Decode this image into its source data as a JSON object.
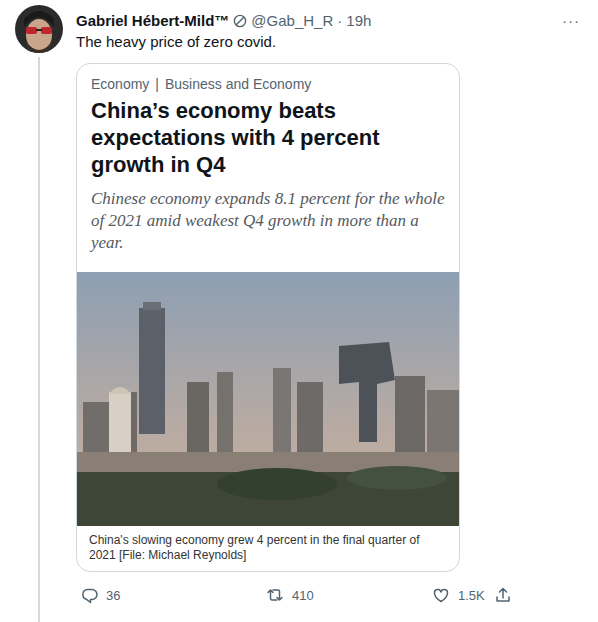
{
  "tweet": {
    "author": {
      "name": "Gabriel Hébert-Mild™",
      "handle": "@Gab_H_R",
      "separator": "·",
      "time": "19h"
    },
    "more": "···",
    "text": "The heavy price of zero covid.",
    "card": {
      "category": "Economy",
      "divider": "|",
      "section": "Business and Economy",
      "headline": "China’s economy beats expectations with 4 percent growth in Q4",
      "subtitle": "Chinese economy expands 8.1 percent for the whole of 2021 amid weakest Q4 growth in more than a year.",
      "caption": "China's slowing economy grew 4 percent in the final quarter of 2021 [File: Michael Reynolds]"
    },
    "stats": {
      "replies": "36",
      "retweets": "410",
      "likes": "1.5K"
    }
  }
}
